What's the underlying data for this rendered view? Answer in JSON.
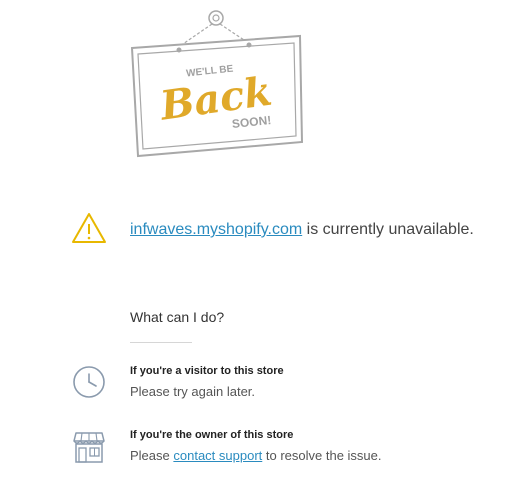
{
  "sign": {
    "line1": "WE'LL BE",
    "line2": "Back",
    "line3": "SOON!",
    "accent_color": "#e0a92a",
    "frame_color": "#a8a8a8"
  },
  "status": {
    "domain_link": "infwaves.myshopify.com",
    "message": " is currently unavailable.",
    "warning_color": "#e8b800"
  },
  "help": {
    "heading": "What can I do?",
    "visitor": {
      "title": "If you're a visitor to this store",
      "text": "Please try again later.",
      "icon": "clock-icon"
    },
    "owner": {
      "title": "If you're the owner of this store",
      "text_before": "Please ",
      "link": "contact support",
      "text_after": " to resolve the issue.",
      "icon": "storefront-icon"
    }
  },
  "colors": {
    "link": "#2a8bbf",
    "icon": "#8a9aad"
  }
}
